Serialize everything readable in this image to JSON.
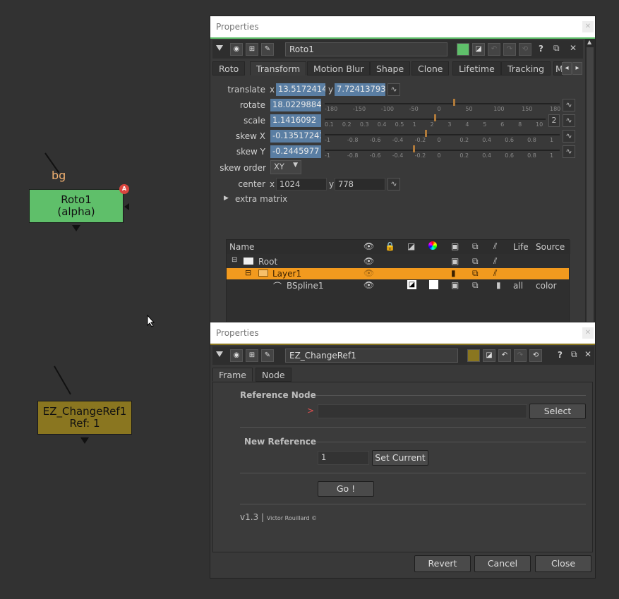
{
  "node_graph": {
    "input_label": "bg",
    "roto_node": {
      "line1": "Roto1",
      "line2": "(alpha)",
      "badge": "A",
      "color": "#5fbf6a"
    },
    "ez_node": {
      "line1": "EZ_ChangeRef1",
      "line2": "Ref: 1",
      "color": "#8a7620"
    }
  },
  "roto_panel": {
    "title": "Properties",
    "node_name": "Roto1",
    "tabs": [
      "Roto",
      "Transform",
      "Motion Blur",
      "Shape",
      "Clone",
      "Lifetime",
      "Tracking",
      "M"
    ],
    "active_tab": "Transform",
    "translate": {
      "label": "translate",
      "x_label": "x",
      "x": "13.5172414",
      "y_label": "y",
      "y": "7.72413793"
    },
    "rotate": {
      "label": "rotate",
      "value": "18.0229884",
      "ticks": [
        "-180",
        "-150",
        "-100",
        "-50",
        "0",
        "50",
        "100",
        "150",
        "180"
      ],
      "level": 0.55
    },
    "scale": {
      "label": "scale",
      "value": "1.1416092",
      "ticks": [
        "0.1",
        "0.2",
        "0.3",
        "0.4",
        "0.5",
        "1",
        "2",
        "3",
        "4",
        "5",
        "6",
        "8",
        "10"
      ],
      "channels": "2",
      "level": 0.5
    },
    "skewx": {
      "label": "skew X",
      "value": "-0.13517241",
      "ticks": [
        "-1",
        "-0.8",
        "-0.6",
        "-0.4",
        "-0.2",
        "0",
        "0.2",
        "0.4",
        "0.6",
        "0.8",
        "1"
      ],
      "level": 0.43
    },
    "skewy": {
      "label": "skew Y",
      "value": "-0.2445977",
      "ticks": [
        "-1",
        "-0.8",
        "-0.6",
        "-0.4",
        "-0.2",
        "0",
        "0.2",
        "0.4",
        "0.6",
        "0.8",
        "1"
      ],
      "level": 0.38
    },
    "skew_order": {
      "label": "skew order",
      "value": "XY"
    },
    "center": {
      "label": "center",
      "x_label": "x",
      "x": "1024",
      "y_label": "y",
      "y": "778"
    },
    "extra_matrix": "extra matrix",
    "table": {
      "headers": {
        "name": "Name",
        "life": "Life",
        "source": "Source"
      },
      "rows": [
        {
          "name": "Root",
          "life": "",
          "source": ""
        },
        {
          "name": "Layer1",
          "life": "",
          "source": ""
        },
        {
          "name": "BSpline1",
          "life": "all",
          "source": "color"
        }
      ],
      "selected_color": "#f29a1e"
    }
  },
  "ez_panel": {
    "title": "Properties",
    "node_name": "EZ_ChangeRef1",
    "tabs": [
      "Frame",
      "Node"
    ],
    "active_tab": "Frame",
    "reference_node_title": "Reference Node",
    "ref_marker": ">",
    "ref_value": "",
    "select_label": "Select",
    "new_reference_title": "New Reference",
    "new_reference_value": "1",
    "set_current_label": "Set Current",
    "go_label": "Go !",
    "version": "v1.3",
    "author": "Victor Rouillard ©",
    "revert_label": "Revert",
    "cancel_label": "Cancel",
    "close_label": "Close"
  }
}
